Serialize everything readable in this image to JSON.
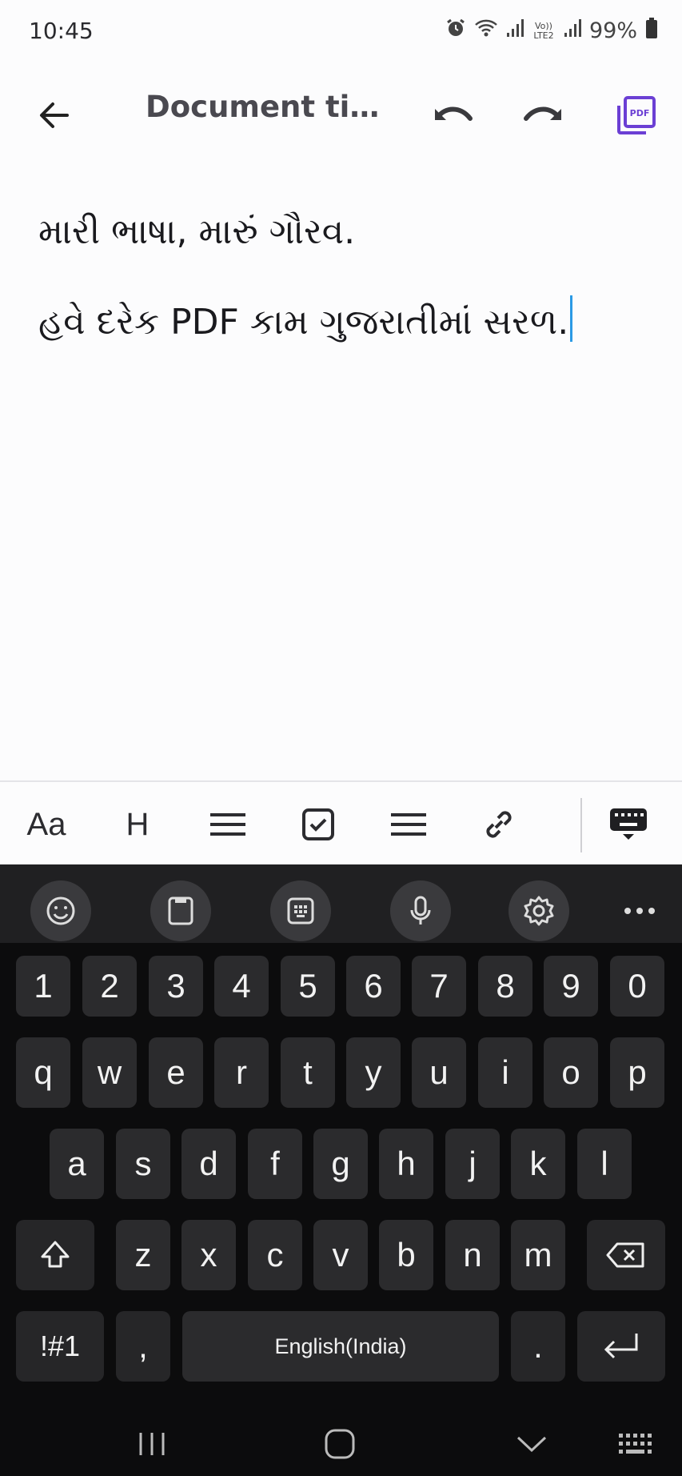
{
  "status_bar": {
    "time": "10:45",
    "network_label": "Vo)) LTE2",
    "battery": "99%"
  },
  "toolbar": {
    "title": "Document titl..."
  },
  "editor": {
    "paragraphs": [
      "મારી ભાષા, મારું ગૌરવ.",
      "હવે દરેક PDF કામ ગુજરાતીમાં સરળ."
    ]
  },
  "format_bar": {
    "font_label": "Aa",
    "heading_label": "H"
  },
  "keyboard": {
    "number_row": [
      "1",
      "2",
      "3",
      "4",
      "5",
      "6",
      "7",
      "8",
      "9",
      "0"
    ],
    "row1": [
      "q",
      "w",
      "e",
      "r",
      "t",
      "y",
      "u",
      "i",
      "o",
      "p"
    ],
    "row2": [
      "a",
      "s",
      "d",
      "f",
      "g",
      "h",
      "j",
      "k",
      "l"
    ],
    "row3": [
      "z",
      "x",
      "c",
      "v",
      "b",
      "n",
      "m"
    ],
    "symbols_label": "!#1",
    "comma_label": ",",
    "space_label": "English(India)",
    "period_label": "."
  },
  "colors": {
    "accent": "#6b3fd4",
    "caret": "#2b9ae5",
    "keyboard_bg": "#0c0c0d",
    "key_bg": "#2b2b2d"
  }
}
